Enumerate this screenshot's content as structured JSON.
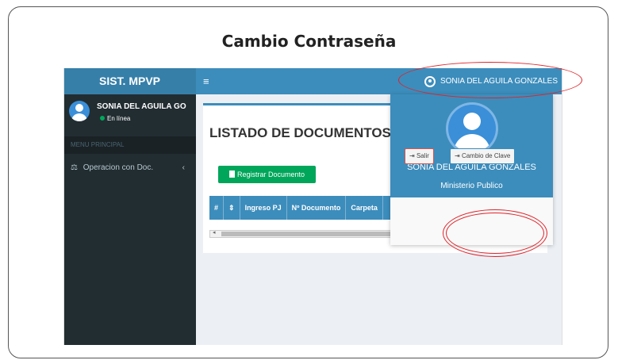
{
  "doc_title": "Cambio Contraseña",
  "app": {
    "brand": "SIST. MPVP",
    "menu_toggle": "≡",
    "topbar_user": "SONIA DEL AGUILA GONZALES"
  },
  "sidebar": {
    "user_name": "SONIA DEL AGUILA GO",
    "status": "En línea",
    "header": "MENU PRINCIPAL",
    "items": [
      {
        "icon": "⚖",
        "label": "Operacion con Doc.",
        "chevron": "‹"
      }
    ]
  },
  "main": {
    "heading": "LISTADO DE DOCUMENTOS",
    "register_button": "Registrar Documento",
    "table_headers": [
      "#",
      "⇕",
      "Ingreso PJ",
      "Nº Documento",
      "Carpeta"
    ],
    "scroll_arrow": "◂"
  },
  "dropdown": {
    "name": "SONIA DEL AGUILA GONZALES",
    "org": "Ministerio Publico",
    "logout_label": "Salir",
    "logout_icon": "⇥",
    "change_password_label": "Cambio de Clave",
    "change_password_icon": "⇥"
  },
  "colors": {
    "brand": "#367fa9",
    "topbar": "#3c8dbc",
    "sidebar": "#222d32",
    "success": "#00a65a",
    "annotation": "#e0242a"
  }
}
